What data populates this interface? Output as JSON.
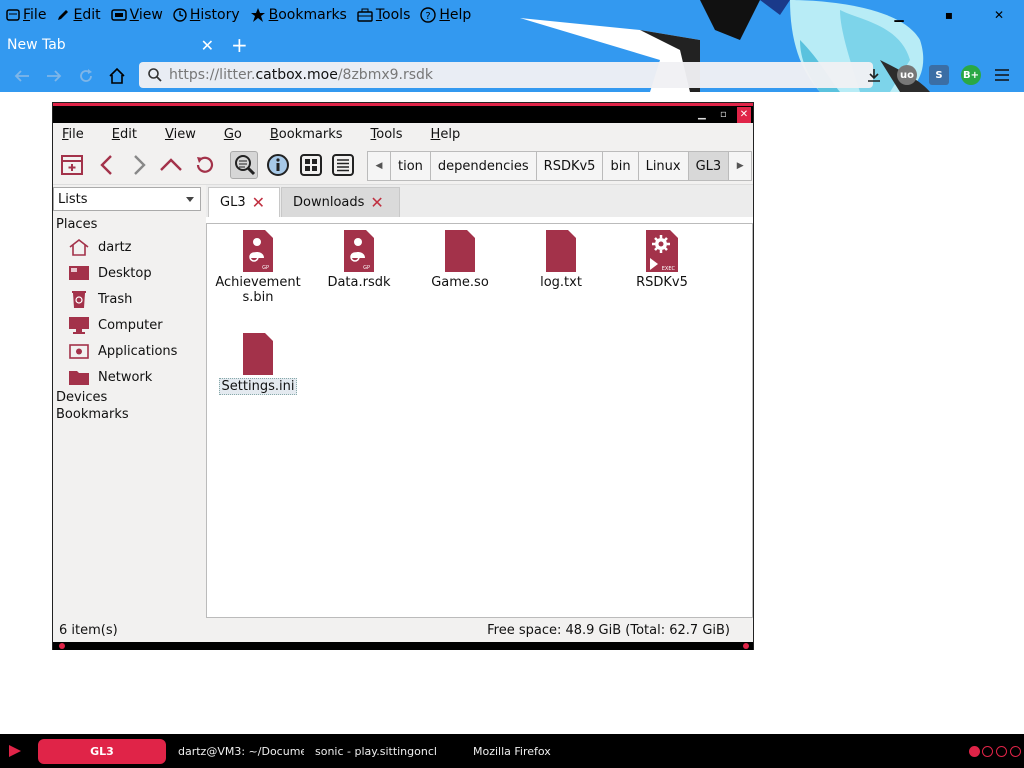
{
  "firefox": {
    "menu": [
      {
        "accel": "F",
        "rest": "ile",
        "icon": "file-icon"
      },
      {
        "accel": "E",
        "rest": "dit",
        "icon": "edit-icon"
      },
      {
        "accel": "V",
        "rest": "iew",
        "icon": "view-icon"
      },
      {
        "accel": "H",
        "rest": "istory",
        "icon": "history-icon"
      },
      {
        "accel": "B",
        "rest": "ookmarks",
        "icon": "bookmarks-icon"
      },
      {
        "accel": "T",
        "rest": "ools",
        "icon": "tools-icon"
      },
      {
        "accel": "H",
        "rest": "elp",
        "icon": "help-icon"
      }
    ],
    "tab_title": "New Tab",
    "url": {
      "prefix": "https://litter.",
      "host": "catbox.moe",
      "path": "/8zbmx9.rsdk"
    },
    "colors": {
      "chrome_blue": "#3399f0",
      "accent": "#e02448"
    }
  },
  "filemanager": {
    "menu": [
      {
        "accel": "F",
        "rest": "ile"
      },
      {
        "accel": "E",
        "rest": "dit"
      },
      {
        "accel": "V",
        "rest": "iew"
      },
      {
        "accel": "G",
        "rest": "o"
      },
      {
        "accel": "B",
        "rest": "ookmarks"
      },
      {
        "accel": "T",
        "rest": "ools"
      },
      {
        "accel": "H",
        "rest": "elp"
      }
    ],
    "breadcrumbs": [
      "tion",
      "dependencies",
      "RSDKv5",
      "bin",
      "Linux",
      "GL3"
    ],
    "side_selector": "Lists",
    "places_heading": "Places",
    "places": [
      {
        "label": "dartz",
        "icon": "home-icon"
      },
      {
        "label": "Desktop",
        "icon": "desktop-icon"
      },
      {
        "label": "Trash",
        "icon": "trash-icon"
      },
      {
        "label": "Computer",
        "icon": "computer-icon"
      },
      {
        "label": "Applications",
        "icon": "applications-icon"
      },
      {
        "label": "Network",
        "icon": "network-icon"
      }
    ],
    "devices_heading": "Devices",
    "bookmarks_heading": "Bookmarks",
    "tabs": [
      {
        "label": "GL3"
      },
      {
        "label": "Downloads"
      }
    ],
    "files": [
      {
        "name": "Achievements.bin",
        "line1": "Achievement",
        "line2": "s.bin",
        "icon": "gpl-file-icon",
        "tag": "GP"
      },
      {
        "name": "Data.rsdk",
        "line1": "Data.rsdk",
        "line2": "",
        "icon": "gpl-file-icon",
        "tag": "GP"
      },
      {
        "name": "Game.so",
        "line1": "Game.so",
        "line2": "",
        "icon": "document-icon",
        "tag": ""
      },
      {
        "name": "log.txt",
        "line1": "log.txt",
        "line2": "",
        "icon": "document-icon",
        "tag": ""
      },
      {
        "name": "RSDKv5",
        "line1": "RSDKv5",
        "line2": "",
        "icon": "executable-icon",
        "tag": "EXEC"
      },
      {
        "name": "Settings.ini",
        "line1": "Settings.ini",
        "line2": "",
        "icon": "document-icon",
        "tag": ""
      }
    ],
    "status_left": "6 item(s)",
    "status_right": "Free space: 48.9 GiB (Total: 62.7 GiB)",
    "file_color": "#a3324a"
  },
  "panel": {
    "tasks": [
      "GL3",
      "dartz@VM3: ~/Docume",
      "sonic - play.sittingoncl",
      "Mozilla Firefox"
    ]
  }
}
